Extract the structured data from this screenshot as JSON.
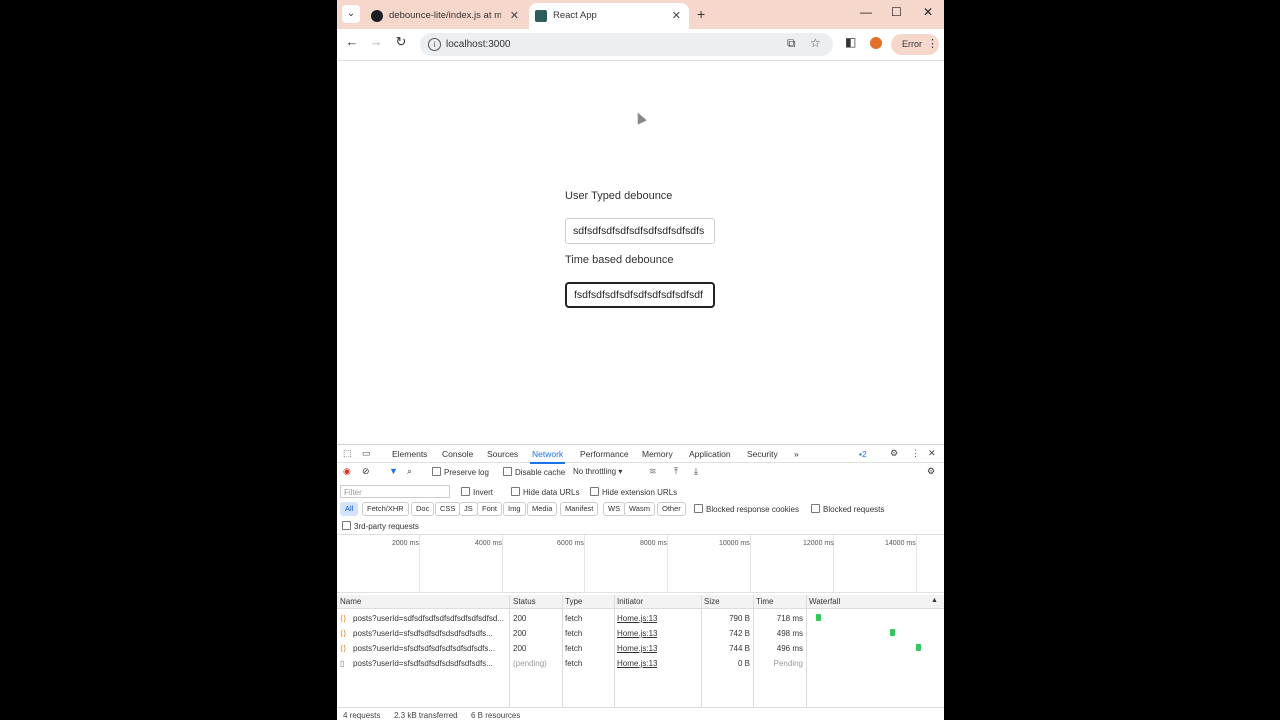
{
  "browser": {
    "tabs": [
      {
        "title": "debounce-lite/index.js at main",
        "favicon": "github-icon"
      },
      {
        "title": "React App",
        "favicon": "react-icon"
      }
    ],
    "url": "localhost:3000",
    "error_label": "Error"
  },
  "page": {
    "label1": "User Typed debounce",
    "input1_value": "sdfsdfsdfsdfsdfsdfsdfsdfsdfs",
    "label2": "Time based debounce",
    "input2_value": "fsdfsdfsdfsdfsdfsdfsdfsdfsdf"
  },
  "devtools": {
    "tabs": [
      "Elements",
      "Console",
      "Sources",
      "Network",
      "Performance",
      "Memory",
      "Application",
      "Security"
    ],
    "more": "»",
    "issues_count": "2",
    "preserve_log": "Preserve log",
    "disable_cache": "Disable cache",
    "throttling": "No throttling",
    "filter_placeholder": "Filter",
    "invert": "Invert",
    "hide_data_urls": "Hide data URLs",
    "hide_extension_urls": "Hide extension URLs",
    "filter_types": [
      "All",
      "Fetch/XHR",
      "Doc",
      "CSS",
      "JS",
      "Font",
      "Img",
      "Media",
      "Manifest",
      "WS",
      "Wasm",
      "Other"
    ],
    "blocked_response_cookies": "Blocked response cookies",
    "blocked_requests": "Blocked requests",
    "third_party": "3rd-party requests",
    "timeline_ticks": [
      "2000 ms",
      "4000 ms",
      "6000 ms",
      "8000 ms",
      "10000 ms",
      "12000 ms",
      "14000 ms"
    ],
    "columns": [
      "Name",
      "Status",
      "Type",
      "Initiator",
      "Size",
      "Time",
      "Waterfall"
    ],
    "requests": [
      {
        "name": "posts?userId=sdfsdfsdfsdfsdfsdfsdfsdfsd...",
        "status": "200",
        "type": "fetch",
        "initiator": "Home.js:13",
        "size": "790 B",
        "time": "718 ms",
        "waterfall": 0.03
      },
      {
        "name": "posts?userId=sfsdfsdfsdfsdsdfsdfsdfs...",
        "status": "200",
        "type": "fetch",
        "initiator": "Home.js:13",
        "size": "742 B",
        "time": "498 ms",
        "waterfall": 0.6
      },
      {
        "name": "posts?userId=sfsdfsdfsdfsdfsdfsdfsdfs...",
        "status": "200",
        "type": "fetch",
        "initiator": "Home.js:13",
        "size": "744 B",
        "time": "496 ms",
        "waterfall": 0.8
      },
      {
        "name": "posts?userId=sfsdfsdfsdfsdsdfsdfsdfs...",
        "status": "(pending)",
        "type": "fetch",
        "initiator": "Home.js:13",
        "size": "0 B",
        "time": "Pending",
        "waterfall": null
      }
    ],
    "summary": {
      "requests": "4 requests",
      "transferred": "2.3 kB transferred",
      "resources": "6 B resources"
    }
  }
}
